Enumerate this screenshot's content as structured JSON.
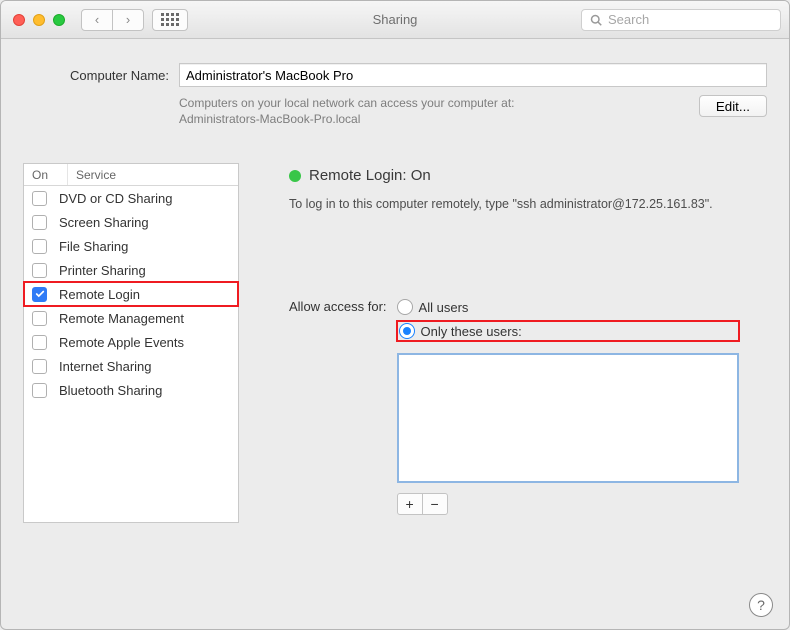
{
  "window_title": "Sharing",
  "search_placeholder": "Search",
  "computer_name_label": "Computer Name:",
  "computer_name_value": "Administrator's MacBook Pro",
  "hostname_hint_line1": "Computers on your local network can access your computer at:",
  "hostname_hint_line2": "Administrators-MacBook-Pro.local",
  "edit_label": "Edit...",
  "table_head_on": "On",
  "table_head_service": "Service",
  "services": [
    {
      "name": "DVD or CD Sharing",
      "on": false,
      "highlight": false
    },
    {
      "name": "Screen Sharing",
      "on": false,
      "highlight": false
    },
    {
      "name": "File Sharing",
      "on": false,
      "highlight": false
    },
    {
      "name": "Printer Sharing",
      "on": false,
      "highlight": false
    },
    {
      "name": "Remote Login",
      "on": true,
      "highlight": true
    },
    {
      "name": "Remote Management",
      "on": false,
      "highlight": false
    },
    {
      "name": "Remote Apple Events",
      "on": false,
      "highlight": false
    },
    {
      "name": "Internet Sharing",
      "on": false,
      "highlight": false
    },
    {
      "name": "Bluetooth Sharing",
      "on": false,
      "highlight": false
    }
  ],
  "status_title": "Remote Login: On",
  "status_subtitle": "To log in to this computer remotely, type \"ssh administrator@172.25.161.83\".",
  "access_label": "Allow access for:",
  "access_options": {
    "all": "All users",
    "only": "Only these users:"
  },
  "access_selected": "only",
  "plus": "+",
  "minus": "−",
  "colors": {
    "accent": "#2f7bf6",
    "status_on": "#39c649",
    "highlight": "#ef1b21"
  }
}
